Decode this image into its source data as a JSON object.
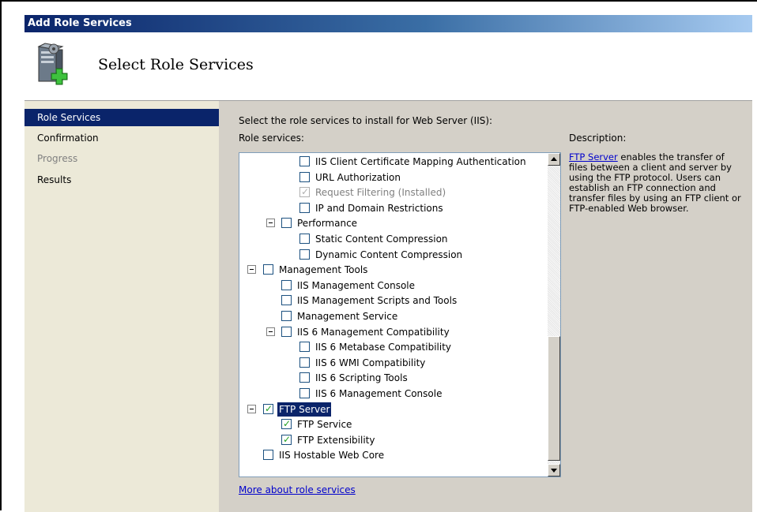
{
  "window": {
    "title": "Add Role Services"
  },
  "header": {
    "title": "Select Role Services",
    "icon": "server-add-icon"
  },
  "nav": {
    "items": [
      {
        "label": "Role Services",
        "state": "active"
      },
      {
        "label": "Confirmation",
        "state": "normal"
      },
      {
        "label": "Progress",
        "state": "disabled"
      },
      {
        "label": "Results",
        "state": "normal"
      }
    ]
  },
  "content": {
    "instruction": "Select the role services to install for Web Server (IIS):",
    "role_services_label": "Role services:",
    "description_label": "Description:",
    "description_link": "FTP Server",
    "description_text": " enables the transfer of files between a client and server by using the FTP protocol. Users can establish an FTP connection and transfer files by using an FTP client or FTP-enabled Web browser.",
    "more_link": "More about role services"
  },
  "tree": {
    "items": [
      {
        "label": "IIS Client Certificate Mapping Authentication",
        "level": 3,
        "checked": false,
        "disabled": false,
        "expander": false
      },
      {
        "label": "URL Authorization",
        "level": 3,
        "checked": false,
        "disabled": false,
        "expander": false
      },
      {
        "label": "Request Filtering  (Installed)",
        "level": 3,
        "checked": true,
        "disabled": true,
        "expander": false
      },
      {
        "label": "IP and Domain Restrictions",
        "level": 3,
        "checked": false,
        "disabled": false,
        "expander": false
      },
      {
        "label": "Performance",
        "level": 2,
        "checked": false,
        "disabled": false,
        "expander": true
      },
      {
        "label": "Static Content Compression",
        "level": 3,
        "checked": false,
        "disabled": false,
        "expander": false
      },
      {
        "label": "Dynamic Content Compression",
        "level": 3,
        "checked": false,
        "disabled": false,
        "expander": false
      },
      {
        "label": "Management Tools",
        "level": 1,
        "checked": false,
        "disabled": false,
        "expander": true
      },
      {
        "label": "IIS Management Console",
        "level": 2,
        "checked": false,
        "disabled": false,
        "expander": false
      },
      {
        "label": "IIS Management Scripts and Tools",
        "level": 2,
        "checked": false,
        "disabled": false,
        "expander": false
      },
      {
        "label": "Management Service",
        "level": 2,
        "checked": false,
        "disabled": false,
        "expander": false
      },
      {
        "label": "IIS 6 Management Compatibility",
        "level": 2,
        "checked": false,
        "disabled": false,
        "expander": true
      },
      {
        "label": "IIS 6 Metabase Compatibility",
        "level": 3,
        "checked": false,
        "disabled": false,
        "expander": false
      },
      {
        "label": "IIS 6 WMI Compatibility",
        "level": 3,
        "checked": false,
        "disabled": false,
        "expander": false
      },
      {
        "label": "IIS 6 Scripting Tools",
        "level": 3,
        "checked": false,
        "disabled": false,
        "expander": false
      },
      {
        "label": "IIS 6 Management Console",
        "level": 3,
        "checked": false,
        "disabled": false,
        "expander": false
      },
      {
        "label": "FTP Server",
        "level": 1,
        "checked": true,
        "disabled": false,
        "expander": true,
        "selected": true
      },
      {
        "label": "FTP Service",
        "level": 2,
        "checked": true,
        "disabled": false,
        "expander": false
      },
      {
        "label": "FTP Extensibility",
        "level": 2,
        "checked": true,
        "disabled": false,
        "expander": false
      },
      {
        "label": "IIS Hostable Web Core",
        "level": 1,
        "checked": false,
        "disabled": false,
        "expander": false
      }
    ]
  }
}
